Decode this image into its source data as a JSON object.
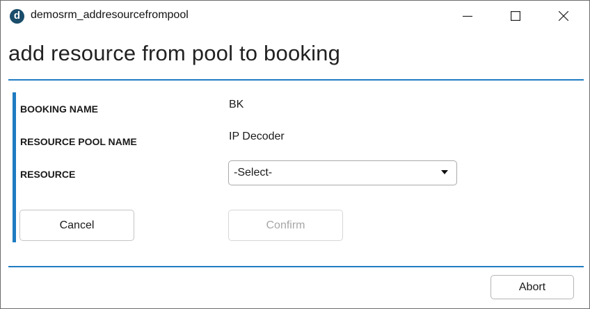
{
  "window": {
    "title": "demosrm_addresourcefrompool",
    "icon_letter": "d",
    "controls": [
      "minimize-icon",
      "maximize-icon",
      "close-icon"
    ]
  },
  "page": {
    "heading": "add resource from pool to booking"
  },
  "form": {
    "booking_name_label": "BOOKING NAME",
    "booking_name_value": "BK",
    "resource_pool_label": "RESOURCE POOL NAME",
    "resource_pool_value": "IP Decoder",
    "resource_label": "RESOURCE",
    "resource_select_value": "-Select-"
  },
  "buttons": {
    "cancel": "Cancel",
    "confirm": "Confirm",
    "abort": "Abort"
  },
  "colors": {
    "accent": "#1f7cc1",
    "disabled_text": "#a6a6a6"
  }
}
